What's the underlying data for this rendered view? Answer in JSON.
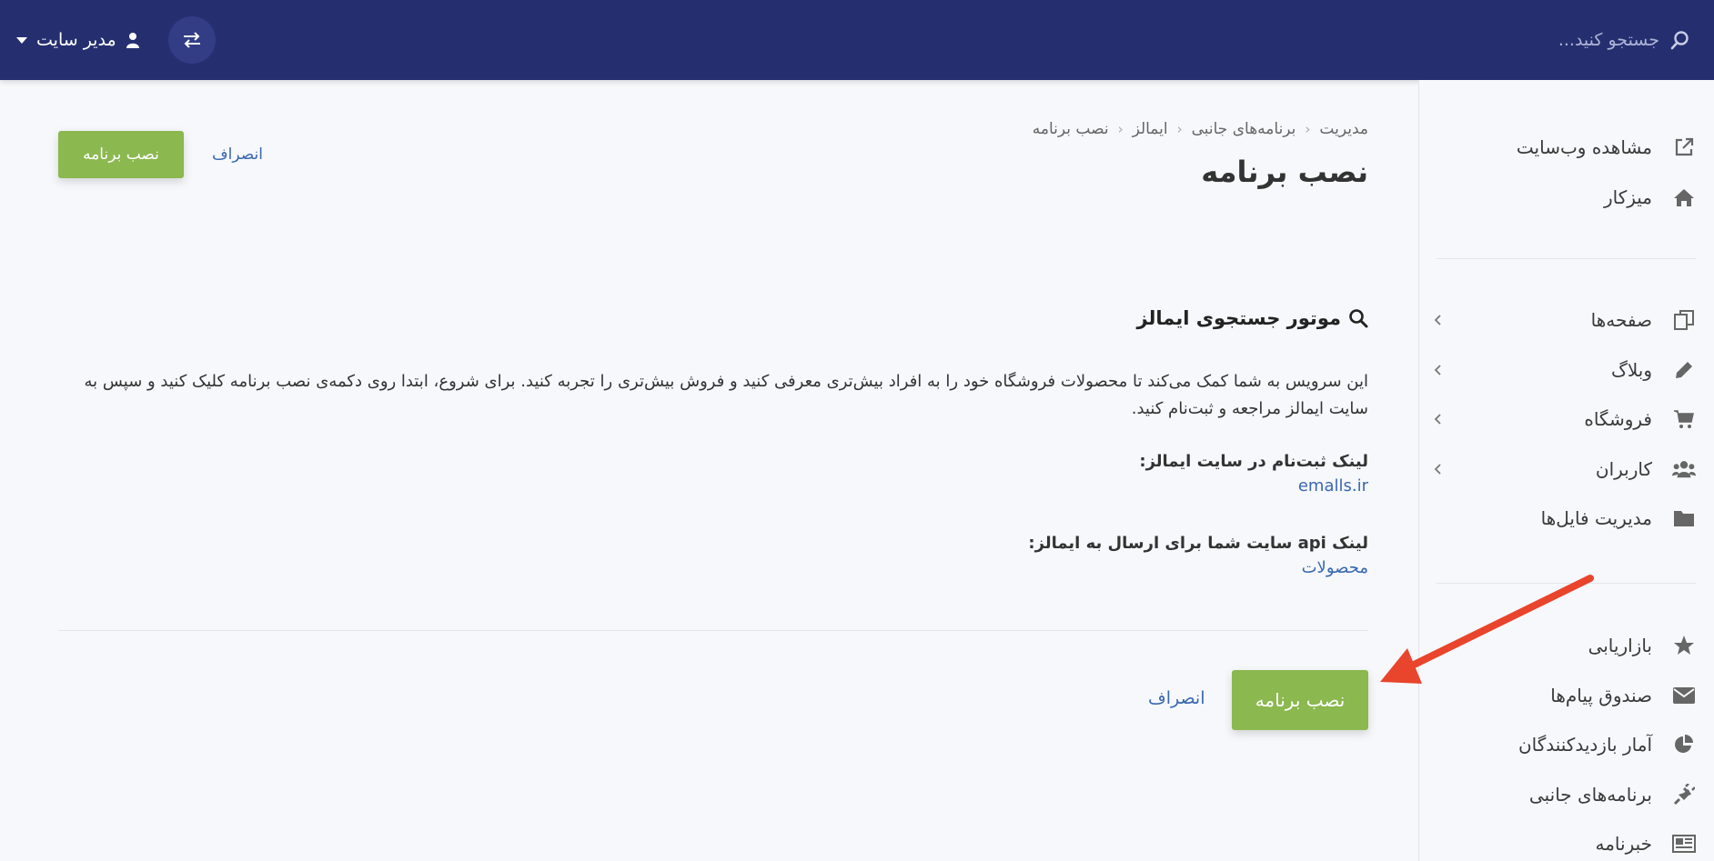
{
  "header": {
    "search_placeholder": "جستجو کنید...",
    "user_name": "مدیر سایت"
  },
  "sidebar": {
    "group1": [
      {
        "label": "مشاهده وب‌سایت",
        "icon": "external-link-icon"
      },
      {
        "label": "میزکار",
        "icon": "home-icon"
      }
    ],
    "group2": [
      {
        "label": "صفحه‌ها",
        "icon": "pages-icon",
        "has_children": true
      },
      {
        "label": "وبلاگ",
        "icon": "pencil-icon",
        "has_children": true
      },
      {
        "label": "فروشگاه",
        "icon": "cart-icon",
        "has_children": true
      },
      {
        "label": "کاربران",
        "icon": "users-icon",
        "has_children": true
      },
      {
        "label": "مدیریت فایل‌ها",
        "icon": "folder-icon",
        "has_children": false
      }
    ],
    "group3": [
      {
        "label": "بازاریابی",
        "icon": "star-icon"
      },
      {
        "label": "صندوق پیام‌ها",
        "icon": "envelope-icon"
      },
      {
        "label": "آمار بازدیدکنندگان",
        "icon": "pie-chart-icon"
      },
      {
        "label": "برنامه‌های جانبی",
        "icon": "plug-icon"
      },
      {
        "label": "خبرنامه",
        "icon": "newspaper-icon"
      }
    ]
  },
  "breadcrumb": [
    "مدیریت",
    "برنامه‌های جانبی",
    "ایمالز",
    "نصب برنامه"
  ],
  "page": {
    "title": "نصب برنامه",
    "install_label": "نصب برنامه",
    "cancel_label": "انصراف"
  },
  "section": {
    "title": "موتور جستجوی ایمالز",
    "description": "این سرویس به شما کمک می‌کند تا محصولات فروشگاه خود را به افراد بیش‌تری معرفی کنید و فروش بیش‌تری را تجربه کنید. برای شروع، ابتدا روی دکمه‌ی نصب برنامه کلیک کنید و سپس به سایت ایمالز مراجعه و ثبت‌نام کنید.",
    "signup_label": "لینک ثبت‌نام در سایت ایمالز:",
    "signup_link": "emalls.ir",
    "api_label": "لینک api سایت شما برای ارسال به ایمالز:",
    "api_link": "محصولات"
  },
  "colors": {
    "header": "#252f70",
    "green": "#8bb84f",
    "link": "#3a68b0",
    "annotation_arrow": "#e8452c"
  }
}
